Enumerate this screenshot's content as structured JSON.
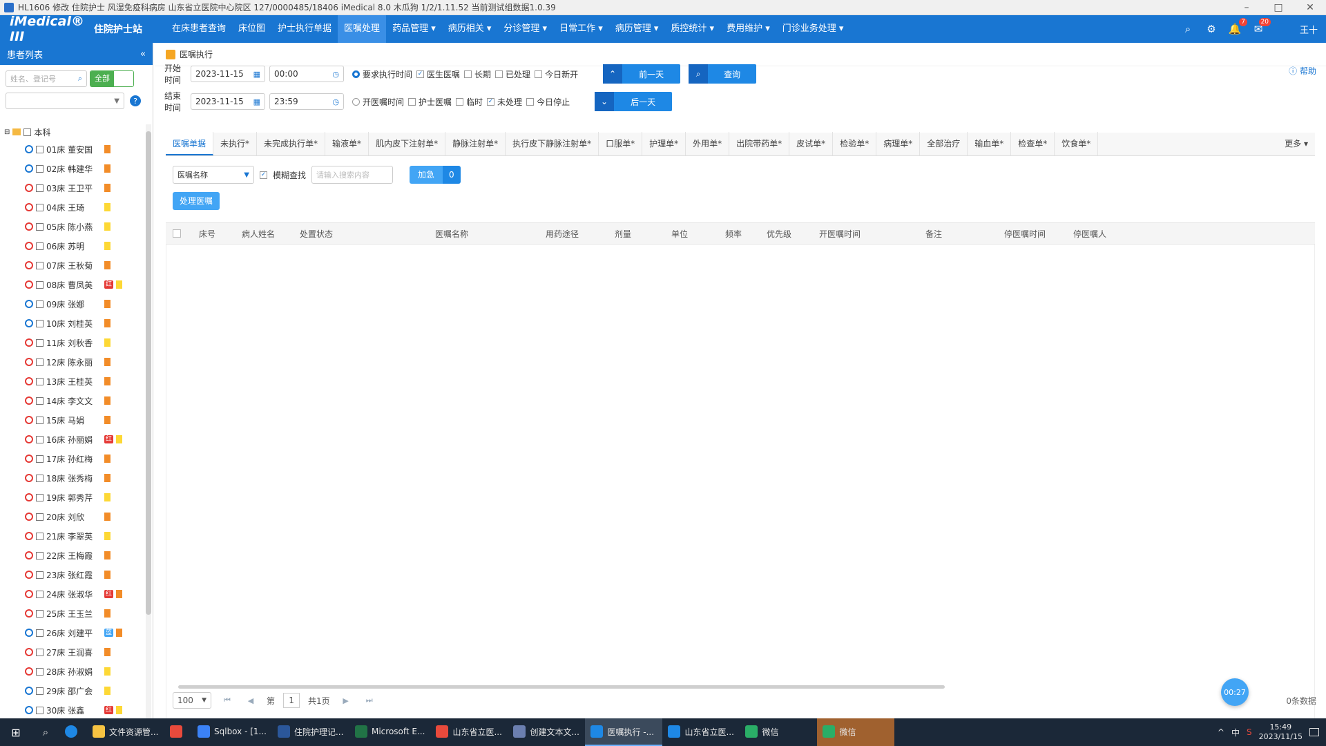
{
  "window": {
    "title": "HL1606 修改 住院护士 风湿免疫科病房 山东省立医院中心院区 127/0000485/18406 iMedical 8.0 木瓜狗 1/2/1.11.52 当前测试组数据1.0.39",
    "btn_min": "–",
    "btn_max": "□",
    "btn_close": "✕"
  },
  "appbar": {
    "logo": "iMedical® III",
    "role": "住院护士站",
    "nav": [
      "在床患者查询",
      "床位图",
      "护士执行单据",
      "医嘱处理",
      "药品管理 ▾",
      "病历相关 ▾",
      "分诊管理 ▾",
      "日常工作 ▾",
      "病历管理 ▾",
      "质控统计 ▾",
      "费用维护 ▾",
      "门诊业务处理 ▾"
    ],
    "active_index": 3,
    "notice_count": "7",
    "message_count": "20",
    "user": "王十"
  },
  "sidebar": {
    "title": "患者列表",
    "collapse": "«",
    "search_placeholder": "姓名、登记号",
    "all_toggle": "全部",
    "help": "?",
    "root_label": "本科",
    "beds": [
      {
        "label": "01床 董安国",
        "sex": "m",
        "flag": "o",
        "mark": ""
      },
      {
        "label": "02床 韩建华",
        "sex": "m",
        "flag": "o",
        "mark": ""
      },
      {
        "label": "03床 王卫平",
        "sex": "f",
        "flag": "o",
        "mark": ""
      },
      {
        "label": "04床 王琦",
        "sex": "f",
        "flag": "y",
        "mark": ""
      },
      {
        "label": "05床 陈小燕",
        "sex": "f",
        "flag": "y",
        "mark": ""
      },
      {
        "label": "06床 苏明",
        "sex": "f",
        "flag": "y",
        "mark": ""
      },
      {
        "label": "07床 王秋菊",
        "sex": "f",
        "flag": "o",
        "mark": ""
      },
      {
        "label": "08床 曹凤英",
        "sex": "f",
        "flag": "y",
        "mark": "红"
      },
      {
        "label": "09床 张娜",
        "sex": "m",
        "flag": "o",
        "mark": ""
      },
      {
        "label": "10床 刘桂英",
        "sex": "m",
        "flag": "o",
        "mark": ""
      },
      {
        "label": "11床 刘秋香",
        "sex": "f",
        "flag": "y",
        "mark": ""
      },
      {
        "label": "12床 陈永丽",
        "sex": "f",
        "flag": "o",
        "mark": ""
      },
      {
        "label": "13床 王桂英",
        "sex": "f",
        "flag": "o",
        "mark": ""
      },
      {
        "label": "14床 李文文",
        "sex": "f",
        "flag": "o",
        "mark": ""
      },
      {
        "label": "15床 马娟",
        "sex": "f",
        "flag": "o",
        "mark": ""
      },
      {
        "label": "16床 孙丽娟",
        "sex": "f",
        "flag": "y",
        "mark": "红"
      },
      {
        "label": "17床 孙红梅",
        "sex": "f",
        "flag": "o",
        "mark": ""
      },
      {
        "label": "18床 张秀梅",
        "sex": "f",
        "flag": "o",
        "mark": ""
      },
      {
        "label": "19床 郭秀芹",
        "sex": "f",
        "flag": "y",
        "mark": ""
      },
      {
        "label": "20床 刘欣",
        "sex": "f",
        "flag": "o",
        "mark": ""
      },
      {
        "label": "21床 李翠英",
        "sex": "f",
        "flag": "y",
        "mark": ""
      },
      {
        "label": "22床 王梅霞",
        "sex": "f",
        "flag": "o",
        "mark": ""
      },
      {
        "label": "23床 张红霞",
        "sex": "f",
        "flag": "o",
        "mark": ""
      },
      {
        "label": "24床 张淑华",
        "sex": "f",
        "flag": "o",
        "mark": "红"
      },
      {
        "label": "25床 王玉兰",
        "sex": "f",
        "flag": "o",
        "mark": ""
      },
      {
        "label": "26床 刘建平",
        "sex": "m",
        "flag": "o",
        "mark": "蓝"
      },
      {
        "label": "27床 王润喜",
        "sex": "f",
        "flag": "o",
        "mark": ""
      },
      {
        "label": "28床 孙淑娟",
        "sex": "f",
        "flag": "y",
        "mark": ""
      },
      {
        "label": "29床 邵广会",
        "sex": "m",
        "flag": "y",
        "mark": ""
      },
      {
        "label": "30床 张鑫",
        "sex": "m",
        "flag": "y",
        "mark": "红"
      }
    ]
  },
  "main": {
    "breadcrumb": "医嘱执行",
    "start_label": "开始时间",
    "end_label": "结束时间",
    "start_date": "2023-11-15",
    "start_time": "00:00",
    "end_date": "2023-11-15",
    "end_time": "23:59",
    "opts_row1": [
      {
        "type": "radio",
        "checked": true,
        "label": "要求执行时间"
      },
      {
        "type": "cb",
        "checked": true,
        "label": "医生医嘱"
      },
      {
        "type": "cb",
        "checked": false,
        "label": "长期"
      },
      {
        "type": "cb",
        "checked": false,
        "label": "已处理"
      },
      {
        "type": "cb",
        "checked": false,
        "label": "今日新开"
      }
    ],
    "opts_row2": [
      {
        "type": "radio",
        "checked": false,
        "label": "开医嘱时间"
      },
      {
        "type": "cb",
        "checked": false,
        "label": "护士医嘱"
      },
      {
        "type": "cb",
        "checked": false,
        "label": "临时"
      },
      {
        "type": "cb",
        "checked": true,
        "label": "未处理"
      },
      {
        "type": "cb",
        "checked": false,
        "label": "今日停止"
      }
    ],
    "prev_day": "前一天",
    "next_day": "后一天",
    "query": "查询",
    "help": "ⓘ 帮助",
    "tabs": [
      "医嘱单据",
      "未执行*",
      "未完成执行单*",
      "输液单*",
      "肌内皮下注射单*",
      "静脉注射单*",
      "执行皮下静脉注射单*",
      "口服单*",
      "护理单*",
      "外用单*",
      "出院带药单*",
      "皮试单*",
      "检验单*",
      "病理单*",
      "全部治疗",
      "输血单*",
      "检查单*",
      "饮食单*",
      "更多 ▾"
    ],
    "select_placeholder": "医嘱名称",
    "fuzzy_label": "模糊查找",
    "search_placeholder": "请输入搜索内容",
    "count_label": "加急",
    "count_value": "0",
    "process_button": "处理医嘱",
    "columns": [
      "床号",
      "病人姓名",
      "处置状态",
      "医嘱名称",
      "用药途径",
      "剂量",
      "单位",
      "频率",
      "优先级",
      "开医嘱时间",
      "备注",
      "停医嘱时间",
      "停医嘱人"
    ],
    "page_size": "100",
    "page_prefix": "第",
    "page_current": "1",
    "page_total": "共1页",
    "records": "0条数据",
    "float_badge": "00:27"
  },
  "taskbar": {
    "apps": [
      {
        "label": "文件资源管...",
        "color": "#f6c342"
      },
      {
        "label": "",
        "color": "#e84a3c"
      },
      {
        "label": "Sqlbox - [1...",
        "color": "#3b82f6"
      },
      {
        "label": "住院护理记...",
        "color": "#2b579a"
      },
      {
        "label": "Microsoft E...",
        "color": "#217346"
      },
      {
        "label": "山东省立医...",
        "color": "#e84a3c"
      },
      {
        "label": "创建文本文...",
        "color": "#6b7fb0"
      },
      {
        "label": "医嘱执行 -...",
        "color": "#1e88e5"
      },
      {
        "label": "山东省立医...",
        "color": "#1e88e5"
      },
      {
        "label": "微信",
        "color": "#2aae67"
      },
      {
        "label": "微信",
        "color": "#2aae67"
      }
    ],
    "active_index": 7,
    "highlight_index": 10,
    "tray": [
      "^",
      "中",
      "S"
    ],
    "time": "15:49",
    "date": "2023/11/15"
  },
  "colors": {
    "primary": "#1976d2",
    "accent": "#42a5f5",
    "male": "#1976d2",
    "female": "#e53935"
  }
}
